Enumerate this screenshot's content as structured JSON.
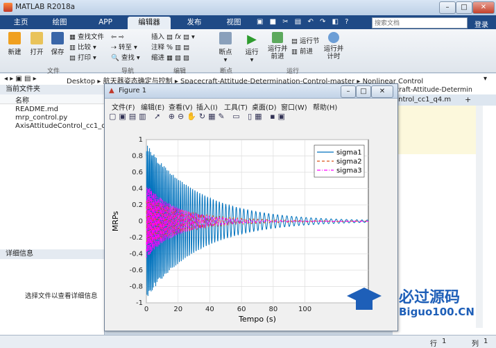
{
  "window": {
    "title": "MATLAB R2018a",
    "search_placeholder": "搜索文档",
    "login": "登录"
  },
  "tabs": [
    "主页",
    "绘图",
    "APP",
    "编辑器",
    "发布",
    "视图"
  ],
  "ribbon": {
    "new": "新建",
    "open": "打开",
    "save": "保存",
    "find_files": "查找文件",
    "compare": "比较",
    "print": "打印",
    "goto": "转至",
    "find": "查找",
    "insert": "插入",
    "comment": "注释",
    "indent": "缩进",
    "breakpoint": "断点",
    "run": "运行",
    "run_advance": "运行并\n前进",
    "run_section": "运行节",
    "advance": "前进",
    "run_time": "运行并\n计时",
    "groups": [
      "文件",
      "导航",
      "编辑",
      "断点",
      "运行"
    ]
  },
  "address": [
    "Desktop",
    "航天器姿态确定与控制",
    "Spacecraft-Attitude-Determination-Control-master",
    "Nonlinear Control"
  ],
  "left_panel": {
    "title": "当前文件夹",
    "col_name": "名称",
    "files": [
      "README.md",
      "mrp_control.py",
      "AxisAttitudeControl_cc1_q4"
    ],
    "details_title": "详细信息",
    "details_hint": "选择文件以查看详细信息"
  },
  "editor": {
    "tab_label": "craft-Attitude-Determin",
    "file_tab": "ontrol_cc1_q4.m"
  },
  "figure": {
    "title": "Figure 1",
    "menu": [
      "文件(F)",
      "编辑(E)",
      "查看(V)",
      "插入(I)",
      "工具(T)",
      "桌面(D)",
      "窗口(W)",
      "帮助(H)"
    ]
  },
  "status": {
    "row_label": "行",
    "row": "1",
    "col_label": "列",
    "col": "1"
  },
  "watermark": {
    "text1": "必过源码",
    "text2": "Biguo100.CN"
  },
  "chart_data": {
    "type": "line",
    "xlabel": "Tempo (s)",
    "ylabel": "MRPs",
    "xlim": [
      0,
      140
    ],
    "ylim": [
      -1,
      1
    ],
    "xticks": [
      0,
      20,
      40,
      60,
      80,
      100
    ],
    "yticks": [
      -1,
      -0.8,
      -0.6,
      -0.4,
      -0.2,
      0,
      0.2,
      0.4,
      0.6,
      0.8,
      1
    ],
    "grid": true,
    "legend_position": "top-right",
    "series": [
      {
        "name": "sigma1",
        "color": "#0072bd",
        "style": "solid",
        "amplitude": 0.95,
        "decay": 0.03,
        "freq_start": 1.6,
        "freq_end": 0.3
      },
      {
        "name": "sigma2",
        "color": "#d95319",
        "style": "dashed",
        "amplitude": 0.3,
        "decay": 0.035,
        "freq_start": 1.4,
        "freq_end": 0.3
      },
      {
        "name": "sigma3",
        "color": "#ff00ff",
        "style": "dashdot",
        "amplitude": 0.45,
        "decay": 0.05,
        "freq_start": 1.8,
        "freq_end": 0.35
      }
    ]
  }
}
